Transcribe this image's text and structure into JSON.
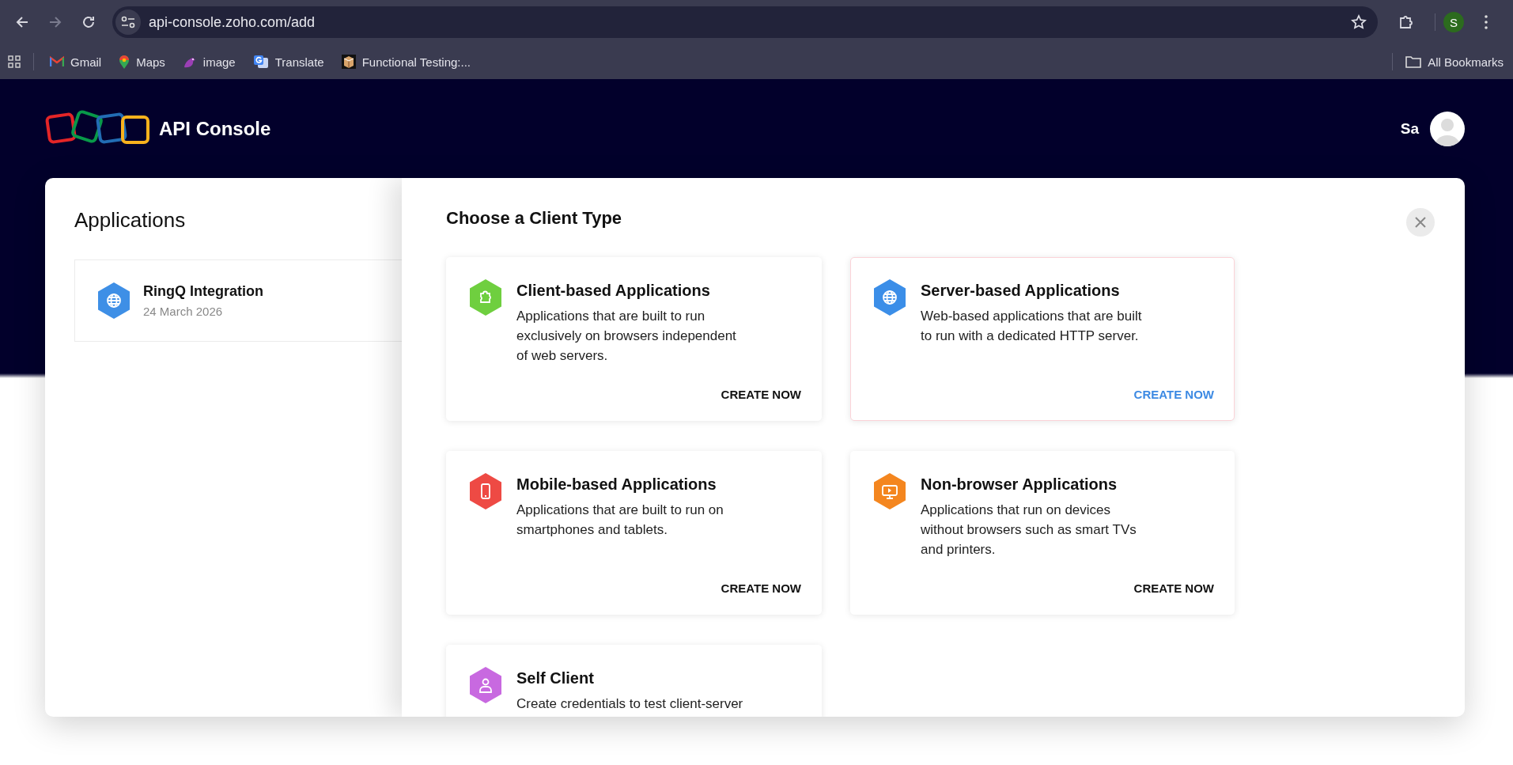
{
  "browser": {
    "url": "api-console.zoho.com/add",
    "forward_disabled": true,
    "profile_initial": "S",
    "bookmarks": [
      {
        "label": "Gmail"
      },
      {
        "label": "Maps"
      },
      {
        "label": "image"
      },
      {
        "label": "Translate"
      },
      {
        "label": "Functional Testing:..."
      }
    ],
    "all_bookmarks": "All Bookmarks"
  },
  "header": {
    "title": "API Console",
    "user": "Sa"
  },
  "applications": {
    "title": "Applications",
    "items": [
      {
        "name": "RingQ Integration",
        "date": "24 March 2026"
      }
    ]
  },
  "client_types": {
    "title": "Choose a Client Type",
    "cards": [
      {
        "title": "Client-based Applications",
        "description": "Applications that are built to run exclusively on browsers independent of web servers.",
        "action": "CREATE NOW",
        "highlighted": false,
        "color": "#6fcf3f"
      },
      {
        "title": "Server-based Applications",
        "description": "Web-based applications that are built to run with a dedicated HTTP server.",
        "action": "CREATE NOW",
        "highlighted": true,
        "color": "#3b8ee8"
      },
      {
        "title": "Mobile-based Applications",
        "description": "Applications that are built to run on smartphones and tablets.",
        "action": "CREATE NOW",
        "highlighted": false,
        "color": "#ee4a44"
      },
      {
        "title": "Non-browser Applications",
        "description": "Applications that run on devices without browsers such as smart TVs and printers.",
        "action": "CREATE NOW",
        "highlighted": false,
        "color": "#f4861f"
      },
      {
        "title": "Self Client",
        "description": "Create credentials to test client-server",
        "highlighted": false,
        "color": "#c869e0"
      }
    ]
  }
}
